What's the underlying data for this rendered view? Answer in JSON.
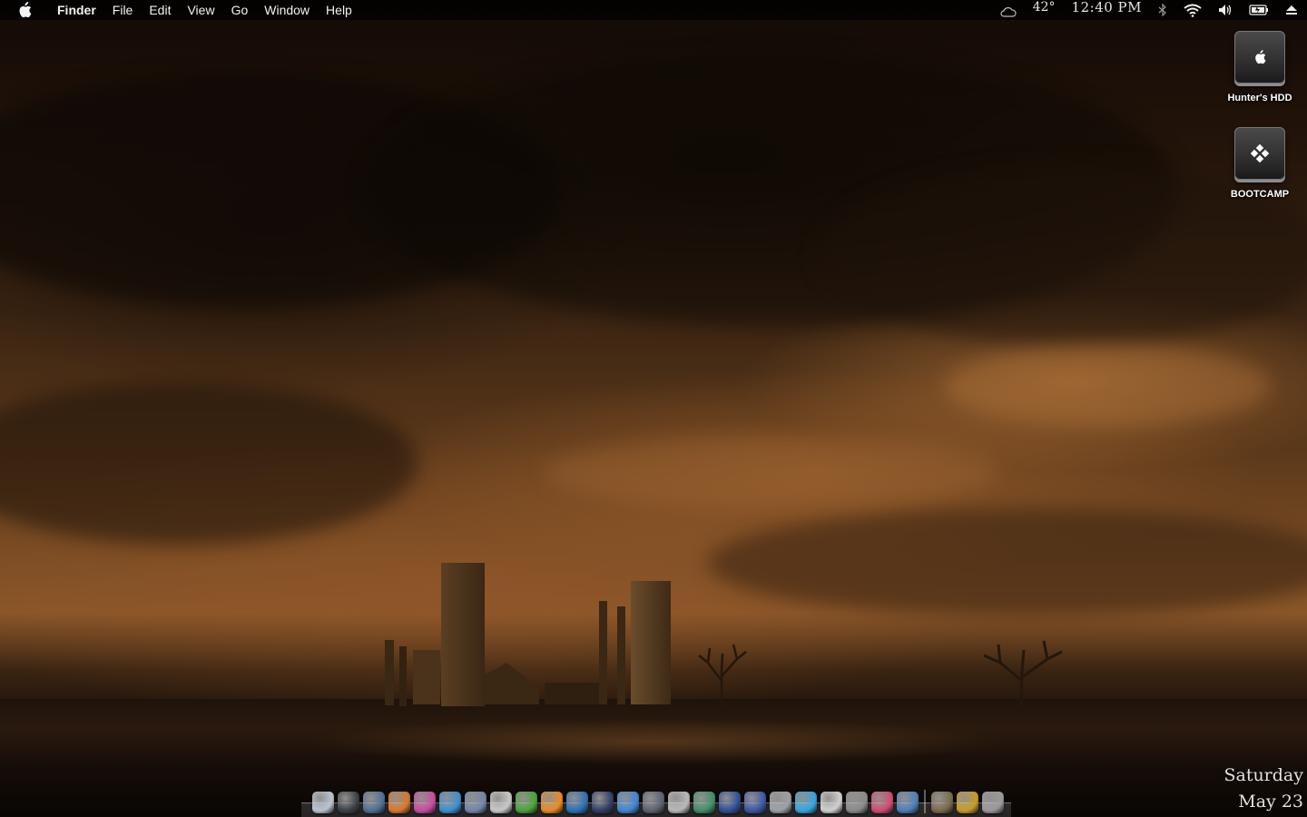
{
  "menubar": {
    "apple_icon": "apple-icon",
    "app_name": "Finder",
    "menus": [
      "File",
      "Edit",
      "View",
      "Go",
      "Window",
      "Help"
    ],
    "status": {
      "weather_icon": "cloud-icon",
      "temperature": "42°",
      "time": "12:40 PM",
      "bluetooth_icon": "bluetooth-icon",
      "wifi_icon": "wifi-icon",
      "volume_icon": "speaker-icon",
      "battery_icon": "battery-icon",
      "eject_icon": "eject-icon"
    }
  },
  "desktop": {
    "drives": [
      {
        "label": "Hunter's HDD",
        "icon": "apple-drive-icon"
      },
      {
        "label": "BOOTCAMP",
        "icon": "windows-drive-icon"
      }
    ]
  },
  "dock": {
    "apps": [
      {
        "icon": "finder-icon",
        "color": "#b9c3cf"
      },
      {
        "icon": "dashboard-icon",
        "color": "#3a3f46"
      },
      {
        "icon": "compass-icon",
        "color": "#4f6f93"
      },
      {
        "icon": "firefox-icon",
        "color": "#d8772a"
      },
      {
        "icon": "color-wheel-icon",
        "color": "#c84aa0"
      },
      {
        "icon": "globe-icon",
        "color": "#3b8fd0"
      },
      {
        "icon": "mail-icon",
        "color": "#6f86a8"
      },
      {
        "icon": "calendar-icon",
        "color": "#c8c8c8"
      },
      {
        "icon": "utorrent-icon",
        "color": "#4aa33a"
      },
      {
        "icon": "vlc-icon",
        "color": "#e98a23"
      },
      {
        "icon": "network-icon",
        "color": "#2d6fb5"
      },
      {
        "icon": "itunes-icon",
        "color": "#2f3f66"
      },
      {
        "icon": "safari-icon",
        "color": "#3c86d6"
      },
      {
        "icon": "xcode-icon",
        "color": "#5b6170"
      },
      {
        "icon": "bowl-icon",
        "color": "#b8b8b8"
      },
      {
        "icon": "earth-icon",
        "color": "#3f8f6a"
      },
      {
        "icon": "facebook-icon",
        "color": "#2d4f97"
      },
      {
        "icon": "word-icon",
        "color": "#3b56a6"
      },
      {
        "icon": "phone-icon",
        "color": "#9aa0a8"
      },
      {
        "icon": "chat-icon",
        "color": "#32a6e0"
      },
      {
        "icon": "printer-icon",
        "color": "#d0d0d0"
      },
      {
        "icon": "gear-icon",
        "color": "#8a8a8a"
      },
      {
        "icon": "pen-icon",
        "color": "#d04a72"
      },
      {
        "icon": "monitor-icon",
        "color": "#4a7fb7"
      }
    ],
    "stacks": [
      {
        "icon": "applications-folder-icon",
        "color": "#7a6a4a"
      },
      {
        "icon": "downloads-folder-icon",
        "color": "#c99b24"
      },
      {
        "icon": "trash-icon",
        "color": "#9a9a9a"
      }
    ]
  },
  "date_widget": {
    "day": "Saturday",
    "date": "May 23"
  }
}
